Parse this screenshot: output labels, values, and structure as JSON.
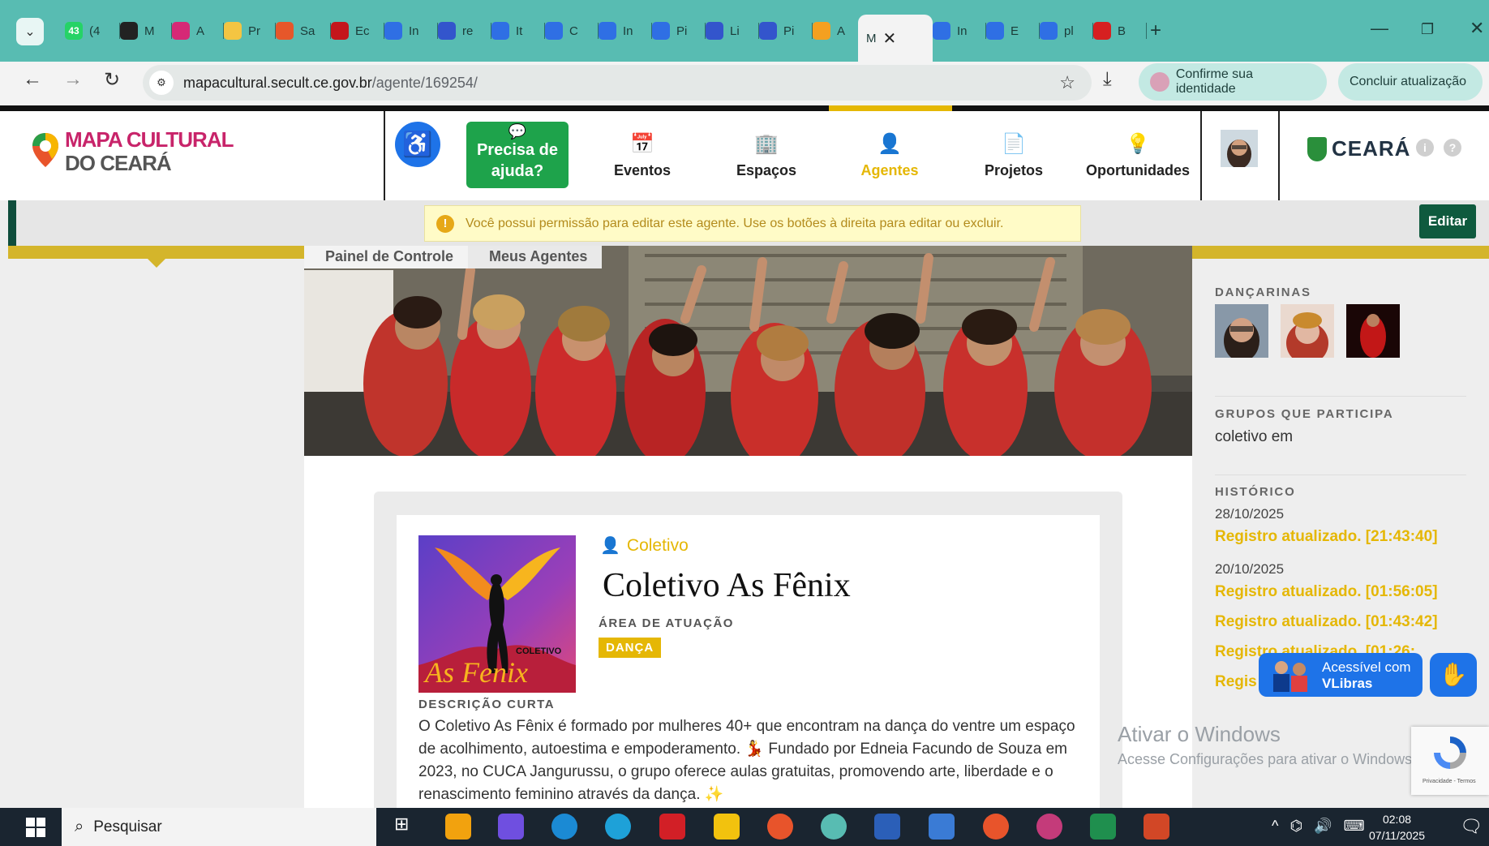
{
  "browser": {
    "tabs": [
      {
        "label": "(4",
        "icon": "whatsapp-icon",
        "badge": "43",
        "color": "#25d366"
      },
      {
        "label": "M",
        "icon": "openai-icon",
        "color": "#222222"
      },
      {
        "label": "A",
        "icon": "instagram-icon",
        "color": "#d62976"
      },
      {
        "label": "Pr",
        "icon": "extension-icon",
        "color": "#f4c542"
      },
      {
        "label": "Sa",
        "icon": "swirl-icon",
        "color": "#e6572a"
      },
      {
        "label": "Ec",
        "icon": "p-icon",
        "color": "#c4161c"
      },
      {
        "label": "In",
        "icon": "circle-c-icon",
        "color": "#2f6fe4"
      },
      {
        "label": "re",
        "icon": "chat-heart-icon",
        "color": "#3355cc"
      },
      {
        "label": "It",
        "icon": "circle-c-icon",
        "color": "#2f6fe4"
      },
      {
        "label": "C",
        "icon": "video-icon",
        "color": "#2f6fe4"
      },
      {
        "label": "In",
        "icon": "video-icon",
        "color": "#2f6fe4"
      },
      {
        "label": "Pi",
        "icon": "circle-c-icon",
        "color": "#2f6fe4"
      },
      {
        "label": "Li",
        "icon": "chat-heart-icon",
        "color": "#3355cc"
      },
      {
        "label": "Pi",
        "icon": "robot-icon",
        "color": "#3355cc"
      },
      {
        "label": "A",
        "icon": "star-arrow-icon",
        "color": "#f4a020"
      },
      {
        "label": "M",
        "icon": "",
        "color": "#444444",
        "active": true
      },
      {
        "label": "In",
        "icon": "circle-c-icon",
        "color": "#2f6fe4"
      },
      {
        "label": "E",
        "icon": "video-icon",
        "color": "#2f6fe4"
      },
      {
        "label": "pl",
        "icon": "circle-c-icon",
        "color": "#2f6fe4"
      },
      {
        "label": "B",
        "icon": "heart-icon",
        "color": "#d62020"
      }
    ],
    "new_tab": "+",
    "close": "✕",
    "url_host": "mapacultural.secult.ce.gov.br",
    "url_path": "/agente/169254/",
    "confirm_identity": "Confirme sua identidade",
    "finish_update": "Concluir atualização"
  },
  "site": {
    "logo_line1": "MAPA CULTURAL",
    "logo_line2": "DO CEARÁ",
    "help_line1": "Precisa de",
    "help_line2": "ajuda?",
    "menu": [
      {
        "label": "Eventos",
        "icon": "calendar-icon",
        "glyph": "📅"
      },
      {
        "label": "Espaços",
        "icon": "building-icon",
        "glyph": "🏢"
      },
      {
        "label": "Agentes",
        "icon": "person-icon",
        "glyph": "👤",
        "active": true
      },
      {
        "label": "Projetos",
        "icon": "document-icon",
        "glyph": "📄"
      },
      {
        "label": "Oportunidades",
        "icon": "lightbulb-icon",
        "glyph": "💡"
      }
    ],
    "gov_logo": "CEARÁ",
    "accent": "#e5b705"
  },
  "notice": {
    "text": "Você possui permissão para editar este agente. Use os botões à direita para editar ou excluir.",
    "edit_label": "Editar"
  },
  "breadcrumb": [
    "Painel de Controle",
    "Meus Agentes"
  ],
  "agent": {
    "type": "Coletivo",
    "name": "Coletivo As Fênix",
    "area_label": "ÁREA DE ATUAÇÃO",
    "area": "DANÇA",
    "avatar_small": "COLETIVO",
    "avatar_script": "As Fenix",
    "desc_label": "DESCRIÇÃO CURTA",
    "description": "O Coletivo As Fênix é formado por mulheres 40+ que encontram na dança do ventre um espaço de acolhimento, autoestima e empoderamento. 💃 Fundado por Edneia Facundo de Souza em 2023, no CUCA Jangurussu, o grupo oferece aulas gratuitas, promovendo arte, liberdade e o renascimento feminino através da dança. ✨"
  },
  "sidebar": {
    "members_title": "DANÇARINAS",
    "groups_title": "GRUPOS QUE PARTICIPA",
    "groups_value": "coletivo em",
    "history_title": "HISTÓRICO",
    "history": [
      {
        "date": "28/10/2025",
        "entries": [
          "Registro atualizado. [21:43:40]"
        ]
      },
      {
        "date": "20/10/2025",
        "entries": [
          "Registro atualizado. [01:56:05]",
          "Registro atualizado. [01:43:42]",
          "Registro atualizado. [01:26:",
          "Regis"
        ]
      }
    ]
  },
  "overlays": {
    "vlibras_line1": "Acessível com",
    "vlibras_line2": "VLibras",
    "windows_title": "Ativar o Windows",
    "windows_sub": "Acesse Configurações para ativar o Windows.",
    "recaptcha": "Privacidade - Termos"
  },
  "taskbar": {
    "search": "Pesquisar",
    "time": "02:08",
    "date": "07/11/2025"
  }
}
